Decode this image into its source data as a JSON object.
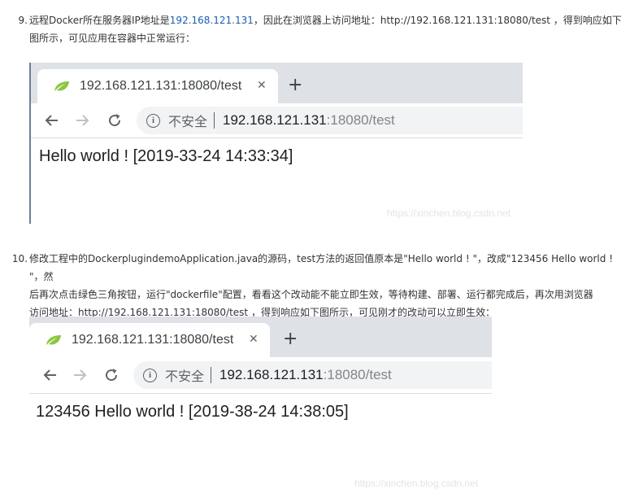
{
  "step9": {
    "number": "9.",
    "line1_pre": "远程Docker所在服务器IP地址是",
    "line1_ip": "192.168.121.131",
    "line1_post": "，因此在浏览器上访问地址：http://192.168.121.131:18080/test ，得到响应如下",
    "line2": "图所示，可见应用在容器中正常运行："
  },
  "browser1": {
    "tab_title": "192.168.121.131:18080/test",
    "close_glyph": "✕",
    "newtab_glyph": "+",
    "security_label": "不安全",
    "url_host": "192.168.121.131",
    "url_path": ":18080/test",
    "page_content": "Hello world ! [2019-33-24 14:33:34]",
    "watermark": "https://xinchen.blog.csdn.net"
  },
  "step10": {
    "number": "10.",
    "line1": "修改工程中的DockerplugindemoApplication.java的源码，test方法的返回值原本是\"Hello world ! \"，改成\"123456 Hello world ! \"，然",
    "line2": "后再次点击绿色三角按钮，运行\"dockerfile\"配置，看看这个改动能不能立即生效，等待构建、部署、运行都完成后，再次用浏览器",
    "line3": "访问地址：http://192.168.121.131:18080/test ，得到响应如下图所示，可见刚才的改动可以立即生效："
  },
  "browser2": {
    "tab_title": "192.168.121.131:18080/test",
    "close_glyph": "✕",
    "newtab_glyph": "+",
    "security_label": "不安全",
    "url_host": "192.168.121.131",
    "url_path": ":18080/test",
    "page_content": "123456 Hello world ! [2019-38-24 14:38:05]",
    "watermark": "https://xinchen.blog.csdn.net"
  },
  "colors": {
    "link": "#1a5fb4",
    "tabstrip": "#dee1e6",
    "omnibox": "#f1f3f4",
    "leaf": "#8cc63f"
  },
  "icons": [
    "spring-leaf-icon",
    "close-icon",
    "new-tab-icon",
    "back-icon",
    "forward-icon",
    "reload-icon",
    "info-icon"
  ]
}
